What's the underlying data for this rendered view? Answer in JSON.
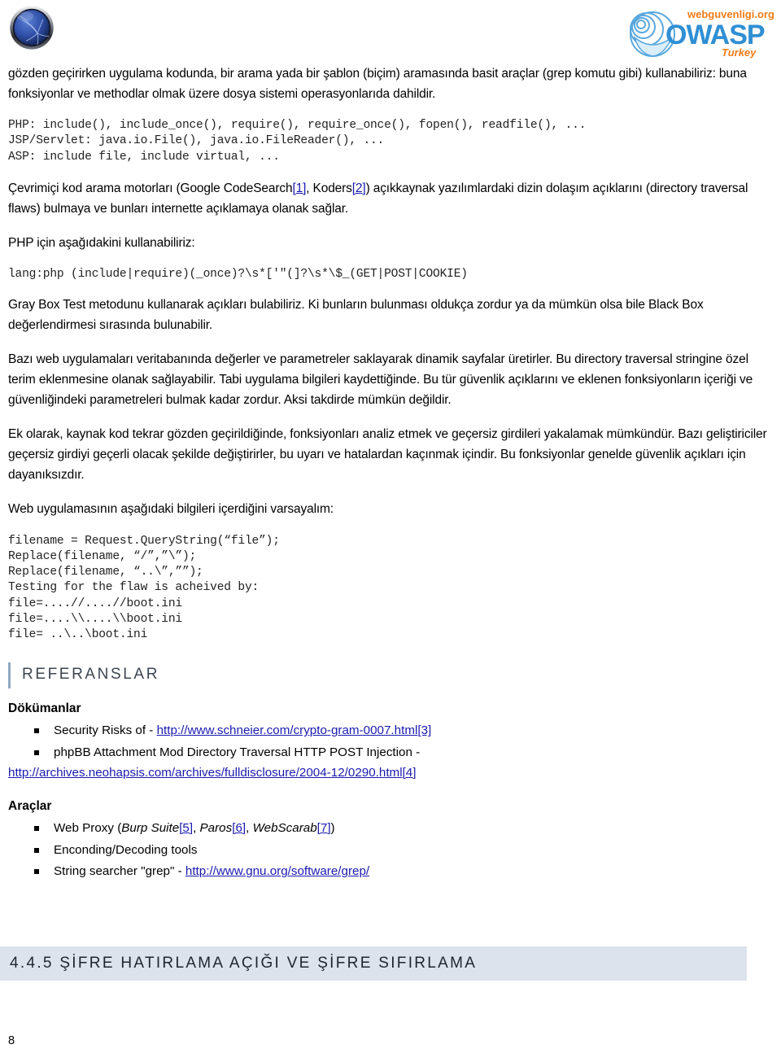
{
  "header": {
    "left_logo": "owasp-sphere-logo",
    "right_logo": "owasp-turkey-logo",
    "right_logo_text_top": "webguvenligi.org",
    "right_logo_text_main": "OWASP",
    "right_logo_text_sub": "Turkey"
  },
  "body": {
    "para1": "gözden geçirirken uygulama kodunda, bir arama yada bir şablon (biçim) aramasında basit araçlar (grep komutu gibi) kullanabiliriz: buna fonksiyonlar ve methodlar olmak üzere dosya sistemi operasyonlarıda dahildir.",
    "code_langs": "PHP: include(), include_once(), require(), require_once(), fopen(), readfile(), ...\nJSP/Servlet: java.io.File(), java.io.FileReader(), ...\nASP: include file, include virtual, ...",
    "para2_a": "Çevrimiçi kod arama motorları (Google CodeSearch",
    "para2_ref1": "[1]",
    "para2_b": ", Koders",
    "para2_ref2": "[2]",
    "para2_c": ") açıkkaynak yazılımlardaki dizin dolaşım açıklarını (directory traversal flaws) bulmaya ve bunları internette açıklamaya olanak sağlar.",
    "para3": "PHP için aşağıdakini kullanabiliriz:",
    "code_regex": "lang:php (include|require)(_once)?\\s*['\"(]?\\s*\\$_(GET|POST|COOKIE)",
    "para4": "Gray Box Test metodunu kullanarak açıkları bulabiliriz. Ki bunların bulunması oldukça zordur ya da mümkün olsa bile Black Box değerlendirmesi sırasında bulunabilir.",
    "para5": "Bazı web uygulamaları veritabanında değerler ve parametreler saklayarak dinamik sayfalar üretirler. Bu directory traversal stringine özel terim eklenmesine olanak sağlayabilir. Tabi uygulama bilgileri kaydettiğinde. Bu tür güvenlik açıklarını ve eklenen fonksiyonların içeriği ve güvenliğindeki parametreleri bulmak kadar zordur. Aksi takdirde mümkün değildir.",
    "para6": "Ek olarak, kaynak kod tekrar gözden geçirildiğinde, fonksiyonları analiz etmek ve geçersiz girdileri yakalamak mümkündür. Bazı geliştiriciler geçersiz girdiyi geçerli olacak şekilde değiştirirler, bu uyarı ve hatalardan kaçınmak içindir. Bu fonksiyonlar genelde güvenlik açıkları için dayanıksızdır.",
    "para7": "Web uygulamasının aşağıdaki bilgileri içerdiğini varsayalım:",
    "code_sample": "filename = Request.QueryString(“file”);\nReplace(filename, “/”,”\\”);\nReplace(filename, “..\\”,””);\nTesting for the flaw is acheived by:\nfile=....//....//boot.ini\nfile=....\\\\....\\\\boot.ini\nfile= ..\\..\\boot.ini"
  },
  "references": {
    "heading": "REFERANSLAR",
    "docs_heading": "Dökümanlar",
    "docs": [
      {
        "text": "Security Risks of - ",
        "url": "http://www.schneier.com/crypto-gram-0007.html",
        "ref": "[3]",
        "wrapped_url": "",
        "wrapped_ref": ""
      },
      {
        "text": "phpBB Attachment Mod Directory Traversal HTTP POST Injection - ",
        "url": "",
        "ref": "",
        "wrapped_url": "http://archives.neohapsis.com/archives/fulldisclosure/2004-12/0290.html",
        "wrapped_ref": "[4]"
      }
    ],
    "tools_heading": "Araçlar",
    "tools": [
      {
        "prefix": "Web Proxy (",
        "items": [
          {
            "name": "Burp Suite",
            "ref": "[5]",
            "sep": ", "
          },
          {
            "name": "Paros",
            "ref": "[6]",
            "sep": ", "
          },
          {
            "name": "WebScarab",
            "ref": "[7]",
            "sep": ""
          }
        ],
        "suffix": ")"
      },
      {
        "plain": "Enconding/Decoding tools"
      },
      {
        "prefix": "String searcher \"grep\" - ",
        "url": "http://www.gnu.org/software/grep/"
      }
    ]
  },
  "section": {
    "number_and_title": "4.4.5 ŞİFRE HATIRLAMA AÇIĞI VE ŞİFRE SIFIRLAMA"
  },
  "footer": {
    "page_number": "8"
  },
  "colors": {
    "link": "#1a1ab0",
    "band": "#dde3ed",
    "refs_accent": "#8fa9c4",
    "refs_text": "#3c4650"
  }
}
